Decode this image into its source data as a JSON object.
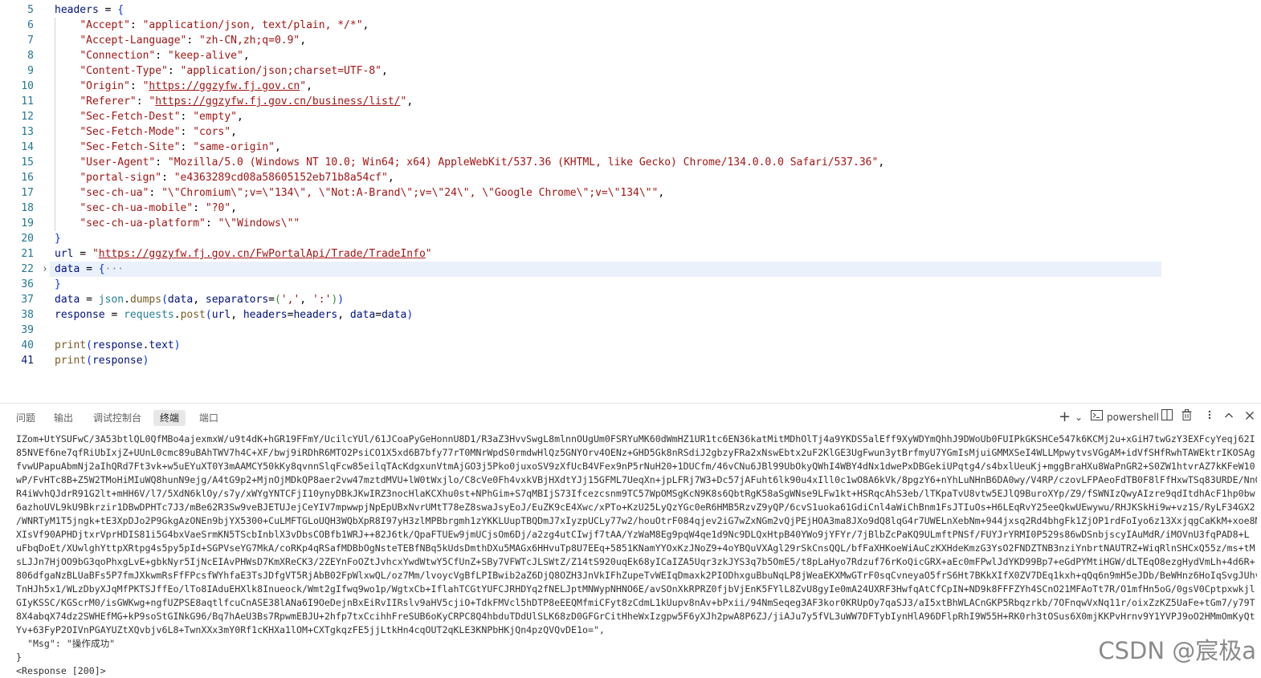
{
  "editor": {
    "lines": [
      {
        "n": "5",
        "indent": 0,
        "code": [
          [
            "v",
            "headers"
          ],
          [
            "p",
            " = "
          ],
          [
            "b1",
            "{"
          ]
        ]
      },
      {
        "n": "6",
        "indent": 1,
        "code": [
          [
            "p",
            "    "
          ],
          [
            "s",
            "\"Accept\""
          ],
          [
            "p",
            ": "
          ],
          [
            "s",
            "\"application/json, text/plain, */*\""
          ],
          [
            "p",
            ","
          ]
        ]
      },
      {
        "n": "7",
        "indent": 1,
        "code": [
          [
            "p",
            "    "
          ],
          [
            "s",
            "\"Accept-Language\""
          ],
          [
            "p",
            ": "
          ],
          [
            "s",
            "\"zh-CN,zh;q=0.9\""
          ],
          [
            "p",
            ","
          ]
        ]
      },
      {
        "n": "8",
        "indent": 1,
        "code": [
          [
            "p",
            "    "
          ],
          [
            "s",
            "\"Connection\""
          ],
          [
            "p",
            ": "
          ],
          [
            "s",
            "\"keep-alive\""
          ],
          [
            "p",
            ","
          ]
        ]
      },
      {
        "n": "9",
        "indent": 1,
        "code": [
          [
            "p",
            "    "
          ],
          [
            "s",
            "\"Content-Type\""
          ],
          [
            "p",
            ": "
          ],
          [
            "s",
            "\"application/json;charset=UTF-8\""
          ],
          [
            "p",
            ","
          ]
        ]
      },
      {
        "n": "10",
        "indent": 1,
        "code": [
          [
            "p",
            "    "
          ],
          [
            "s",
            "\"Origin\""
          ],
          [
            "p",
            ": "
          ],
          [
            "s",
            "\""
          ],
          [
            "su",
            "https://ggzyfw.fj.gov.cn"
          ],
          [
            "s",
            "\""
          ],
          [
            "p",
            ","
          ]
        ]
      },
      {
        "n": "11",
        "indent": 1,
        "code": [
          [
            "p",
            "    "
          ],
          [
            "s",
            "\"Referer\""
          ],
          [
            "p",
            ": "
          ],
          [
            "s",
            "\""
          ],
          [
            "su",
            "https://ggzyfw.fj.gov.cn/business/list/"
          ],
          [
            "s",
            "\""
          ],
          [
            "p",
            ","
          ]
        ]
      },
      {
        "n": "12",
        "indent": 1,
        "code": [
          [
            "p",
            "    "
          ],
          [
            "s",
            "\"Sec-Fetch-Dest\""
          ],
          [
            "p",
            ": "
          ],
          [
            "s",
            "\"empty\""
          ],
          [
            "p",
            ","
          ]
        ]
      },
      {
        "n": "13",
        "indent": 1,
        "code": [
          [
            "p",
            "    "
          ],
          [
            "s",
            "\"Sec-Fetch-Mode\""
          ],
          [
            "p",
            ": "
          ],
          [
            "s",
            "\"cors\""
          ],
          [
            "p",
            ","
          ]
        ]
      },
      {
        "n": "14",
        "indent": 1,
        "code": [
          [
            "p",
            "    "
          ],
          [
            "s",
            "\"Sec-Fetch-Site\""
          ],
          [
            "p",
            ": "
          ],
          [
            "s",
            "\"same-origin\""
          ],
          [
            "p",
            ","
          ]
        ]
      },
      {
        "n": "15",
        "indent": 1,
        "code": [
          [
            "p",
            "    "
          ],
          [
            "s",
            "\"User-Agent\""
          ],
          [
            "p",
            ": "
          ],
          [
            "s",
            "\"Mozilla/5.0 (Windows NT 10.0; Win64; x64) AppleWebKit/537.36 (KHTML, like Gecko) Chrome/134.0.0.0 Safari/537.36\""
          ],
          [
            "p",
            ","
          ]
        ]
      },
      {
        "n": "16",
        "indent": 1,
        "code": [
          [
            "p",
            "    "
          ],
          [
            "s",
            "\"portal-sign\""
          ],
          [
            "p",
            ": "
          ],
          [
            "s",
            "\"e4363289cd08a58605152eb71b8a54cf\""
          ],
          [
            "p",
            ","
          ]
        ]
      },
      {
        "n": "17",
        "indent": 1,
        "code": [
          [
            "p",
            "    "
          ],
          [
            "s",
            "\"sec-ch-ua\""
          ],
          [
            "p",
            ": "
          ],
          [
            "s",
            "\"\\\"Chromium\\\";v=\\\"134\\\", \\\"Not:A-Brand\\\";v=\\\"24\\\", \\\"Google Chrome\\\";v=\\\"134\\\"\""
          ],
          [
            "p",
            ","
          ]
        ]
      },
      {
        "n": "18",
        "indent": 1,
        "code": [
          [
            "p",
            "    "
          ],
          [
            "s",
            "\"sec-ch-ua-mobile\""
          ],
          [
            "p",
            ": "
          ],
          [
            "s",
            "\"?0\""
          ],
          [
            "p",
            ","
          ]
        ]
      },
      {
        "n": "19",
        "indent": 1,
        "code": [
          [
            "p",
            "    "
          ],
          [
            "s",
            "\"sec-ch-ua-platform\""
          ],
          [
            "p",
            ": "
          ],
          [
            "s",
            "\"\\\"Windows\\\"\""
          ]
        ]
      },
      {
        "n": "20",
        "indent": 0,
        "code": [
          [
            "b1",
            "}"
          ]
        ]
      },
      {
        "n": "21",
        "indent": 0,
        "code": [
          [
            "v",
            "url"
          ],
          [
            "p",
            " = "
          ],
          [
            "s",
            "\""
          ],
          [
            "su",
            "https://ggzyfw.fj.gov.cn/FwPortalApi/Trade/TradeInfo"
          ],
          [
            "s",
            "\""
          ]
        ]
      },
      {
        "n": "22",
        "indent": 0,
        "fold": "›",
        "highlight": true,
        "code": [
          [
            "v",
            "data"
          ],
          [
            "p",
            " = "
          ],
          [
            "b1",
            "{"
          ],
          [
            "c",
            "···"
          ]
        ]
      },
      {
        "n": "36",
        "indent": 0,
        "code": [
          [
            "b1",
            "}"
          ]
        ]
      },
      {
        "n": "37",
        "indent": 0,
        "code": [
          [
            "v",
            "data"
          ],
          [
            "p",
            " = "
          ],
          [
            "t",
            "json"
          ],
          [
            "p",
            "."
          ],
          [
            "f",
            "dumps"
          ],
          [
            "b1",
            "("
          ],
          [
            "v",
            "data"
          ],
          [
            "p",
            ", "
          ],
          [
            "v",
            "separators"
          ],
          [
            "p",
            "="
          ],
          [
            "b2",
            "("
          ],
          [
            "s",
            "','"
          ],
          [
            "p",
            ", "
          ],
          [
            "s",
            "':'"
          ],
          [
            "b2",
            ")"
          ],
          [
            "b1",
            ")"
          ]
        ]
      },
      {
        "n": "38",
        "indent": 0,
        "code": [
          [
            "v",
            "response"
          ],
          [
            "p",
            " = "
          ],
          [
            "t",
            "requests"
          ],
          [
            "p",
            "."
          ],
          [
            "f",
            "post"
          ],
          [
            "b1",
            "("
          ],
          [
            "v",
            "url"
          ],
          [
            "p",
            ", "
          ],
          [
            "v",
            "headers"
          ],
          [
            "p",
            "="
          ],
          [
            "v",
            "headers"
          ],
          [
            "p",
            ", "
          ],
          [
            "v",
            "data"
          ],
          [
            "p",
            "="
          ],
          [
            "v",
            "data"
          ],
          [
            "b1",
            ")"
          ]
        ]
      },
      {
        "n": "39",
        "indent": 0,
        "code": []
      },
      {
        "n": "40",
        "indent": 0,
        "code": [
          [
            "f",
            "print"
          ],
          [
            "b1",
            "("
          ],
          [
            "v",
            "response"
          ],
          [
            "p",
            "."
          ],
          [
            "v",
            "text"
          ],
          [
            "b1",
            ")"
          ]
        ]
      },
      {
        "n": "41",
        "indent": 0,
        "current": true,
        "code": [
          [
            "f",
            "print"
          ],
          [
            "b1",
            "("
          ],
          [
            "v",
            "response"
          ],
          [
            "b1",
            ")"
          ]
        ]
      }
    ]
  },
  "panel": {
    "tabs": [
      "问题",
      "输出",
      "调试控制台",
      "终端",
      "端口"
    ],
    "active_tab": "终端",
    "actions": {
      "add": "+",
      "add_menu": "⌄",
      "shell": "powershell",
      "split": "◫",
      "trash": "🗑",
      "maximize": "^",
      "close": "×"
    }
  },
  "terminal": {
    "lines": [
      "IZom+UtYSUFwC/3A53btlQL0QfMBo4ajexmxW/u9t4dK+hGR19FFmY/UcilcYUl/61JCoaPyGeHonnU8D1/R3aZ3HvvSwgL8mlnnOUgUm0FSRYuMK60dWmHZ1UR1tc6EN36katMitMDhOlTj4a9YKDS5alEff9XyWDYmQhhJ9DWoUb0FUIPkGKSHCe547k6KCMj2u+xGiH7twGzY3EXFcyYeqj62I",
      "85NVEf6ne7qfRiUbIxjZ+UUnL0cmc89uBAhTWV7h4C+XF/bwj9iRDhR6MTO2PsiCO1X5xd6B7bfy77rT0MNrWpdS0rmdwHlQz5GNYOrv4OENz+GHD5Gk8nRSdiJ2gbzyFRa2xNswEbtx2uF2KlGE3UgFwun3ytBrfmyU7YGmIsMjuiGMMXSeI4WLLMpwytvsVGgAM+idVfSHfRwhTAWEktrIKOSAg",
      "fvwUPapuAbmNj2aIhQRd7Ft3vk+w5uEYuXT0Y3mAAMCY50kKy8qvnnSlqFcw85eilqTAcKdgxunVtmAjGO3j5Pko0juxoSV9zXfUcB4VFex9nP5rNuH20+1DUCfm/46vCNu6JBl99UbOkyQWhI4WBY4dNx1dwePxDBGekiUPqtg4/s4bxlUeuKj+mggBraHXu8WaPnGR2+S0ZW1htvrAZ7kKFeW10",
      "wP/FvHTc8B+Z5W2TMoHiMIuWQ8hunN9ejg/A4tG9p2+MjnOjMDkQP8aer2vw47mztdMVU+lW0tWxjlo/C8cVe0Fh4vxkVBjHXdtYJj15GFML7UeqXn+jpLFRj7W3+Dc57jAFuht6lk90u4xIll0c1wO8A6kVk/8pgzY6+nYhLuNHnB6DA0wy/V4RP/czovLFPAeoFdTB0F8lFfHxwTSq83URDE/NnG2w",
      "R4iWvhQJdrR91G2lt+mHH6V/l7/5XdN6klOy/s7y/xWYgYNTCFjI10ynyDBkJKwIRZ3nocHlaKCXhu0st+NPhGim+S7qMBIjS73Ifcezcsnm9TC57WpOMSgKcN9K8s6QbtRgK58aSgWNse9LFw1kt+HSRqcAhS3eb/lTKpaTvU8vtw5EJlQ9BuroXYp/Z9/fSWNIzQwyAIzre9qdItdhAcF1hp0bw",
      "6azhoUVL9kU9Bkrzir1DBwDPHTc7J3/mBe62R3Sw9veBJETUJejCeYIV7mpwwpjNpEpUBxNvrUMtT78eZ8swaJsyEoJ/EuZK9cE4Xwc/xPTo+KzU25LyQzYGc0eR6HMB5RzvZ9yQP/6cvS1uoka61GdiCnl4aWiChBnm1FsJTIuOs+H6LEqRvY25eeQkwUEwywu/RHJKSkHi9w+vz1S/RyLF34GX2",
      "/WNRTyM1T5jngk+tE3XpDJo2P9GkgAzONEn9bjYX5300+CuLMFTGLoUQH3WQbXpR8I97yH3zlMPBbrgmh1zYKKLUupTBQDmJ7xIyzpUCLy77w2/houOtrF084qjev2iG7wZxNGm2vQjPEjHOA3ma8JXo9dQ8lqG4r7UWELnXebNm+944jxsq2Rd4bhgFk1ZjOP1rdFoIyo6z13XxjqgCaKkM+xoe8M",
      "XIsVf90APHDjtxrVprHDIS81i5G4bxVaeSrmKN5TScbInblX3vDbsCOBfb1WRJ++82J6tk/QpaFTUEw9jmUCjsOm6Dj/a2zg4utCIwjf7tAA/YzWaM8Eg9pqW4qe1d9Nc9DLQxHtpB40YWo9jYFYr/7jBlbZcPaKQ9ULmftPNSf/FUYJrYRMI0P529s86wDSnbjscyIAuMdR/iMOVnU3fqPAD8+L",
      "uFbqDoEt/XUwlghYttpXRtpg4s5py5pId+SGPVseYG7MkA/coRKp4qRSafMDBbOgNsteTEBfNBq5kUdsDmthDXu5MAGx6HHvuTp8U7EEq+5851KNamYYOxKzJNoZ9+4oYBQuVXAgl29rSkCnsQQL/bfFaXHKoeWiAuCzKXHdeKmzG3YsO2FNDZTNB3nziYnbrtNAUTRZ+WiqRlnSHCxQ55z/ms+tM",
      "sLJJn7HjOO9bG3qoPhxgLvE+gbkNyr5IjNcEIAvPHWsD7KmXReCK3/2ZEYnFoOZtJvhcxYwdWtwY5CfUnZ+SBy7VFWTcJLSWtZ/Z14tS920uqEk68yICaIZA5Uqr3zkJYS3q7b5OmE5/t8pLaHyo7Rdzuf76rKoQicGRX+aEc0mFPwlJdYKD99Bp7+eGdPYMtiHGW/dLTEqO8ezgHydVmLh+4d6R+",
      "806dfgaNzBLUaBFs5P7fmJXkwmRsFfFPcsfWYhfaE3TsJDfgVT5RjAbB02FpWlxwQL/oz7Mm/lvoycVgBfLPIBwib2aZ6DjQ8OZH3JnVkIFhZupeTvWEIqDmaxk2PIODhxguBbuNqLP8jWeaEKXMwGTrF0sqCvneyaO5frS6Ht7BKkXIfX0ZV7DEq1kxh+qQq6n9mH5eJDb/BeWHnz6HoIqSvgJUhv",
      "TnHJh5x1/WLzDbyXJqMfPKTSJffEo/lTo8IAduEHXlk8Inueock/Wmt2gIfwq9wo1p/WgtxCb+IflahTCGtYUFCJRHDYq2fNELJptMNWypNHNO6E/avSOnXkRPRZ0fjbVjEnK5FYlL8ZvU8gyIe0mA24UXRF3HwfqAtCfCpIN+ND9k8FFFZYh4SCnO21MFAoTt7R/O1mfHn5oG/0gsV0Cptpxwkjl",
      "GIyKSSC/KGScrM0/isGWKwg+ngfUZPSE8aqtlfcuCnASE38lANa6I9OeDejnBxEiRvIIRslv9aHV5cjiO+TdkFMVcl5hDTP8eEEQMfmiCFyt8zCdmL1kUupv8nAv+bPxii/94NmSeqeg3AF3kor0KRUpOy7qaSJ3/aI5xtBhWLACnGKP5Rbqzrkb/7OFnqwVxNq11r/oixZzKZ5UaFe+tGm7/y79T",
      "8X4abqX74dz2SWHEfMG+kP9soStGINkG96/Bq7hAeU3Bs7RpwmEBJU+2hfp7txCcihhFreSUB6oKyCRPC8Q4hbduTDdUlSLK68zD0GFGrCitHheWxIzgpw5F6yXJh2pwA8P6ZJ/jiAJu7y5fVL3uWW7DFTybIynHlA96DFlpRhI9W55H+RK0rh3tOSus6X0mjKKPvHrnv9Y1YVPJ9oO2HMmOmKyQt",
      "Yv+63FyP2OIVnPGAYUZtXQvbjv6L8+TwnXXx3mY0Rf1cKHXa1lOM+CXTgkqzFE5jjLtkHn4cqOUT2qKLE3KNPbHKjQn4pzQVQvDE1o=\",",
      "  \"Msg\": \"操作成功\"",
      "}",
      "<Response [200]>"
    ]
  },
  "watermark": "CSDN @宸极a"
}
